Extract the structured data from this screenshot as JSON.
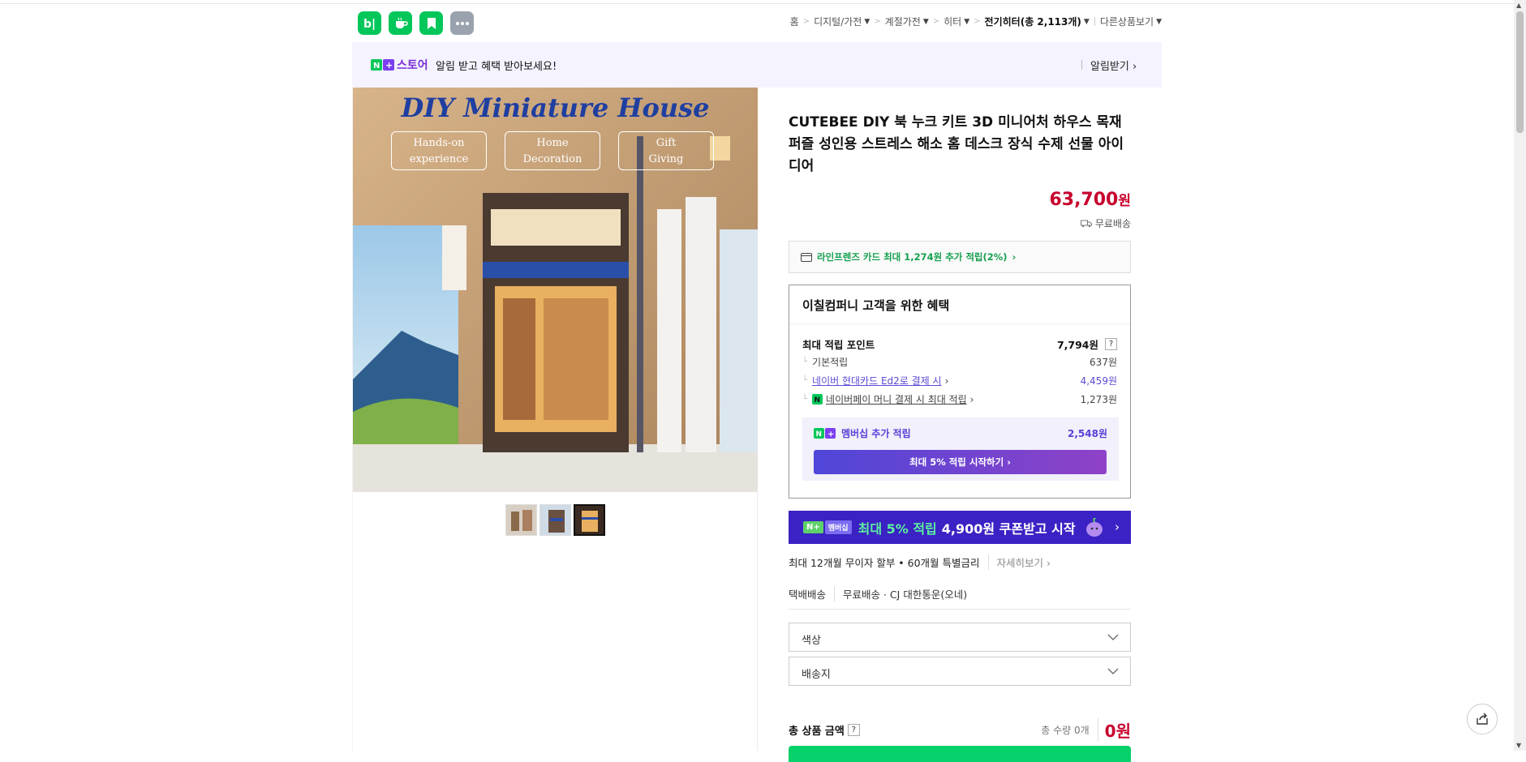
{
  "header": {
    "apps": [
      {
        "name": "blog-app-icon",
        "glyph": "b|",
        "color": "#03c75a"
      },
      {
        "name": "cafe-app-icon",
        "glyph": "☕",
        "color": "#03c75a"
      },
      {
        "name": "bookmark-app-icon",
        "glyph": "🔖",
        "color": "#03c75a"
      },
      {
        "name": "more-apps-icon",
        "glyph": "⋯",
        "color": "#9aa3ad"
      }
    ],
    "breadcrumb": {
      "home": "홈",
      "cat1": "디지털/가전",
      "cat2": "계절가전",
      "cat3": "히터",
      "current": "전기히터(총 2,113개)",
      "other": "다른상품보기"
    }
  },
  "alert": {
    "store": "스토어",
    "message": "알림 받고 혜택 받아보세요!",
    "subscribe": "알림받기"
  },
  "product": {
    "title": "CUTEBEE DIY 북 누크 키트 3D 미니어처 하우스 목재 퍼즐 성인용 스트레스 해소 홈 데스크 장식 수제 선물 아이디어",
    "price": "63,700",
    "currency": "원",
    "shipping": "무료배송",
    "card_offer": "라인프렌즈 카드 최대 1,274원 추가 적립(2%)",
    "image": {
      "banner": "DIY Miniature House",
      "badge1": "Hands-on experience",
      "badge2": "Home Decoration",
      "badge3": "Gift Giving"
    }
  },
  "benefit": {
    "heading": "이칠컴퍼니 고객을 위한 혜택",
    "max_points_label": "최대 적립 포인트",
    "max_points_value": "7,794원",
    "basic_label": "기본적립",
    "basic_value": "637원",
    "card_label": "네이버 현대카드 Ed2로 결제 시",
    "card_value": "4,459원",
    "pay_label": "네이버페이 머니 결제 시 최대 적립",
    "pay_value": "1,273원",
    "membership_label": "멤버십 추가 적립",
    "membership_value": "2,548원",
    "membership_button": "최대 5% 적립 시작하기"
  },
  "coupon": {
    "tag": "멤버십",
    "highlight": "최대 5% 적립",
    "text": "4,900원 쿠폰받고 시작"
  },
  "installment": {
    "text": "최대 12개월 무이자 할부 • 60개월 특별금리",
    "more": "자세히보기"
  },
  "delivery": {
    "type": "택배배송",
    "detail": "무료배송 · CJ 대한통운(오네)"
  },
  "options": {
    "color": "색상",
    "destination": "배송지"
  },
  "total": {
    "label": "총 상품 금액",
    "qty": "총 수량 0개",
    "amount": "0원"
  }
}
